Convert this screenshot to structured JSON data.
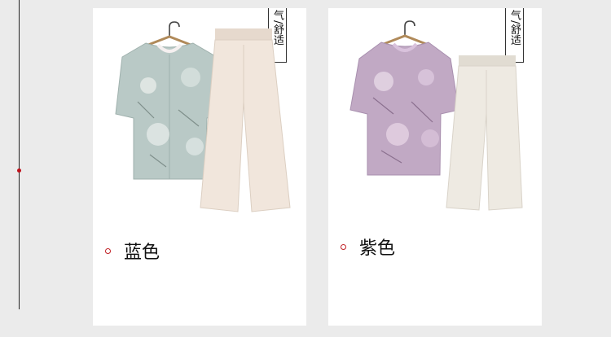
{
  "cards": [
    {
      "tag": "气/舒适",
      "color_name": "蓝色",
      "palette": {
        "shirt": "#b9c9c6",
        "shirt_shade": "#a7b9b6",
        "pants": "#f1e6dc",
        "pants_shade": "#e6d9cd",
        "accent": "#c01f24"
      }
    },
    {
      "tag": "气/舒适",
      "color_name": "紫色",
      "palette": {
        "shirt": "#c1a9c4",
        "shirt_shade": "#ad95b2",
        "pants": "#eeeae2",
        "pants_shade": "#e1dcd2",
        "accent": "#c01f24"
      }
    }
  ],
  "icons": {
    "hanger": "hanger-icon",
    "bullet": "bullet-icon"
  }
}
